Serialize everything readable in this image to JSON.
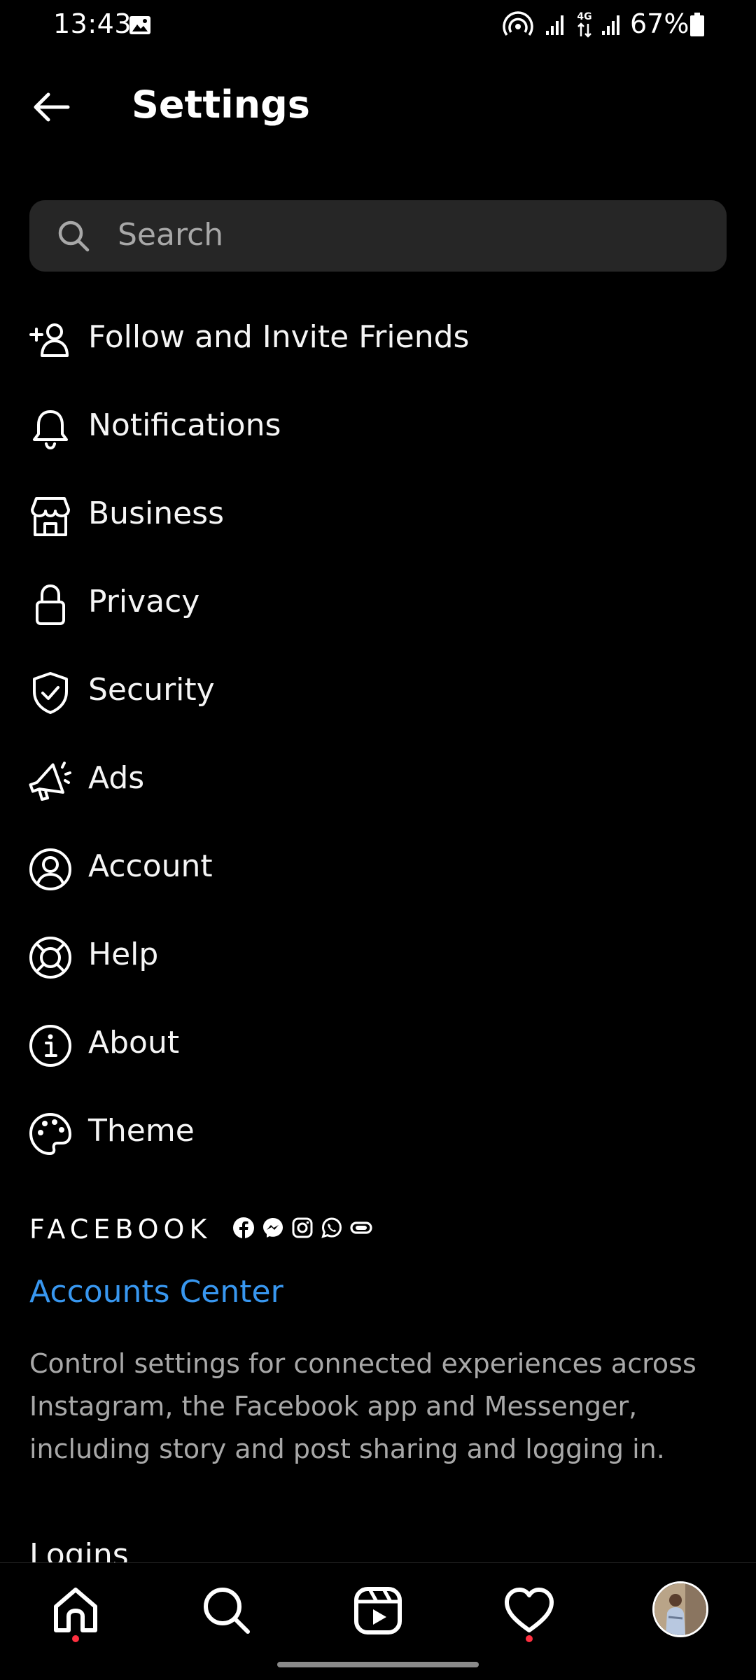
{
  "status_bar": {
    "time": "13:43",
    "network": "4G",
    "battery": "67%"
  },
  "header": {
    "title": "Settings",
    "back_icon": "arrow-left-icon"
  },
  "search": {
    "placeholder": "Search",
    "icon": "search-icon"
  },
  "menu": {
    "items": [
      {
        "label": "Follow and Invite Friends",
        "icon": "add-person-icon"
      },
      {
        "label": "Notifications",
        "icon": "bell-icon"
      },
      {
        "label": "Business",
        "icon": "storefront-icon"
      },
      {
        "label": "Privacy",
        "icon": "lock-icon"
      },
      {
        "label": "Security",
        "icon": "shield-check-icon"
      },
      {
        "label": "Ads",
        "icon": "megaphone-icon"
      },
      {
        "label": "Account",
        "icon": "account-circle-icon"
      },
      {
        "label": "Help",
        "icon": "lifebuoy-icon"
      },
      {
        "label": "About",
        "icon": "info-circle-icon"
      },
      {
        "label": "Theme",
        "icon": "palette-icon"
      }
    ]
  },
  "facebook_section": {
    "wordmark": "FACEBOOK",
    "app_icons": [
      "facebook-icon",
      "messenger-icon",
      "instagram-icon",
      "whatsapp-icon",
      "oculus-icon"
    ],
    "accounts_center": "Accounts Center",
    "description": "Control settings for connected experiences across Instagram, the Facebook app and Messenger, including story and post sharing and logging in."
  },
  "logins": {
    "heading": "Logins"
  },
  "bottom_nav": {
    "items": [
      "home-icon",
      "search-icon",
      "reels-icon",
      "heart-icon",
      "profile-avatar"
    ]
  },
  "colors": {
    "background": "#000000",
    "search_bg": "#262626",
    "link_blue": "#3897f0",
    "secondary_text": "#a8a8a8",
    "notification_dot": "#ff3040"
  }
}
